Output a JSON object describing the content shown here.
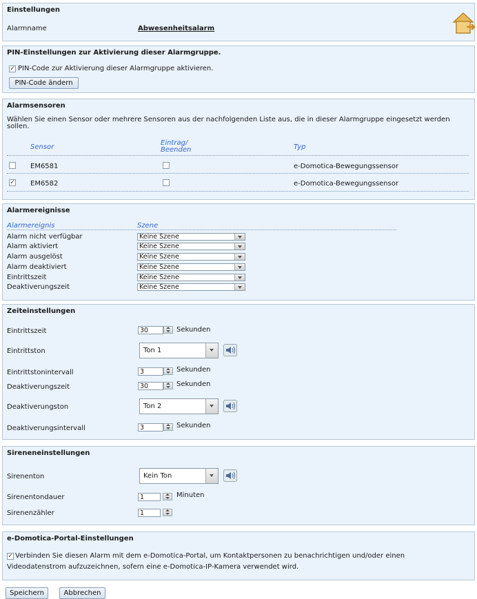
{
  "einstellungen": {
    "title": "Einstellungen",
    "alarmname_label": "Alarmname",
    "alarmname_value": "Abwesenheitsalarm"
  },
  "pin": {
    "title": "PIN-Einstellungen zur Aktivierung dieser Alarmgruppe.",
    "checkbox_label": "PIN-Code zur Aktivierung dieser Alarmgruppe aktivieren.",
    "button": "PIN-Code ändern"
  },
  "sensoren": {
    "title": "Alarmsensoren",
    "desc": "Wählen Sie einen Sensor oder mehrere Sensoren aus der nachfolgenden Liste aus, die in dieser Alarmgruppe eingesetzt werden sollen.",
    "col_sensor": "Sensor",
    "col_eintrag_1": "Eintrag/",
    "col_eintrag_2": "Beenden",
    "col_typ": "Typ",
    "rows": [
      {
        "name": "EM6581",
        "type": "e-Domotica-Bewegungssensor",
        "checked": false
      },
      {
        "name": "EM6582",
        "type": "e-Domotica-Bewegungssensor",
        "checked": true
      }
    ]
  },
  "ereignisse": {
    "title": "Alarmereignisse",
    "col_event": "Alarmereignis",
    "col_scene": "Szene",
    "rows": [
      {
        "label": "Alarm nicht verfügbar",
        "scene": "Keine Szene"
      },
      {
        "label": "Alarm aktiviert",
        "scene": "Keine Szene"
      },
      {
        "label": "Alarm ausgelöst",
        "scene": "Keine Szene"
      },
      {
        "label": "Alarm deaktiviert",
        "scene": "Keine Szene"
      },
      {
        "label": "Eintrittszeit",
        "scene": "Keine Szene"
      },
      {
        "label": "Deaktiverungszeit",
        "scene": "Keine Szene"
      }
    ]
  },
  "zeit": {
    "title": "Zeiteinstellungen",
    "eintrittszeit_label": "Eintrittszeit",
    "eintrittszeit_value": "30",
    "sekunden": "Sekunden",
    "eintrittston_label": "Eintrittston",
    "eintrittston_value": "Ton 1",
    "eintrittstonintervall_label": "Eintrittstonintervall",
    "eintrittstonintervall_value": "3",
    "deaktivierungszeit_label": "Deaktiverungszeit",
    "deaktivierungszeit_value": "30",
    "deaktivierungston_label": "Deaktiverungston",
    "deaktivierungston_value": "Ton 2",
    "deaktivierungsintervall_label": "Deaktiverungsintervall",
    "deaktivierungsintervall_value": "3"
  },
  "sirene": {
    "title": "Sireneneinstellungen",
    "sirenenton_label": "Sirenenton",
    "sirenenton_value": "Kein Ton",
    "dauer_label": "Sirenentondauer",
    "dauer_value": "1",
    "minuten": "Minuten",
    "zaehler_label": "Sirenenzähler",
    "zaehler_value": "1"
  },
  "portal": {
    "title": "e-Domotica-Portal-Einstellungen",
    "text_1": "Verbinden Sie diesen Alarm mit dem e-Domotica-Portal, um Kontaktpersonen zu benachrichtigen und/oder einen",
    "text_2": "Videodatenstrom aufzuzeichnen, sofern eine e-Domotica-IP-Kamera verwendet wird."
  },
  "actions": {
    "save": "Speichern",
    "cancel": "Abbrechen"
  },
  "colors": {
    "panel_bg": "#eaf3fb",
    "header_text": "#3366cc",
    "house_icon": "#e8b95a"
  }
}
